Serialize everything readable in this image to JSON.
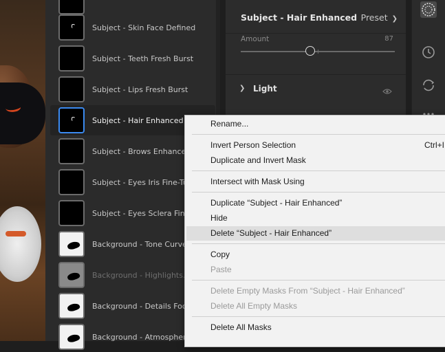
{
  "mask_list": {
    "items": [
      {
        "label": "",
        "thumb": "black"
      },
      {
        "label": "Subject - Skin Face Defined",
        "thumb": "black-speck"
      },
      {
        "label": "Subject - Teeth Fresh Burst",
        "thumb": "black"
      },
      {
        "label": "Subject - Lips Fresh Burst",
        "thumb": "black"
      },
      {
        "label": "Subject - Hair Enhanced",
        "thumb": "black-speck",
        "selected": true
      },
      {
        "label": "Subject - Brows Enhanced",
        "thumb": "black"
      },
      {
        "label": "Subject - Eyes Iris Fine-Tun",
        "thumb": "black"
      },
      {
        "label": "Subject - Eyes Sclera Fine-T",
        "thumb": "black"
      },
      {
        "label": "Background - Tone Curve M",
        "thumb": "white"
      },
      {
        "label": "Background - Highlights...",
        "thumb": "gray",
        "dim": true
      },
      {
        "label": "Background - Details Focus",
        "thumb": "white"
      },
      {
        "label": "Background - Atmosphere Boken...",
        "thumb": "white"
      }
    ]
  },
  "properties": {
    "title": "Subject - Hair Enhanced",
    "preset_label": "Preset",
    "amount_label": "Amount",
    "amount_value": "87",
    "amount_fraction": 0.45,
    "section_light": "Light"
  },
  "context_menu": {
    "rename": "Rename...",
    "invert_person": "Invert Person Selection",
    "invert_shortcut": "Ctrl+I",
    "duplicate_invert": "Duplicate and Invert Mask",
    "intersect": "Intersect with Mask Using",
    "duplicate": "Duplicate “Subject - Hair Enhanced”",
    "hide": "Hide",
    "delete": "Delete “Subject - Hair Enhanced”",
    "copy": "Copy",
    "paste": "Paste",
    "delete_empty_from": "Delete Empty Masks From “Subject - Hair Enhanced”",
    "delete_all_empty": "Delete All Empty Masks",
    "delete_all": "Delete All Masks"
  },
  "colors": {
    "accent_selected": "#3b8af0",
    "menu_bg": "#f2f2f2",
    "panel_bg": "#2b2b2b"
  }
}
